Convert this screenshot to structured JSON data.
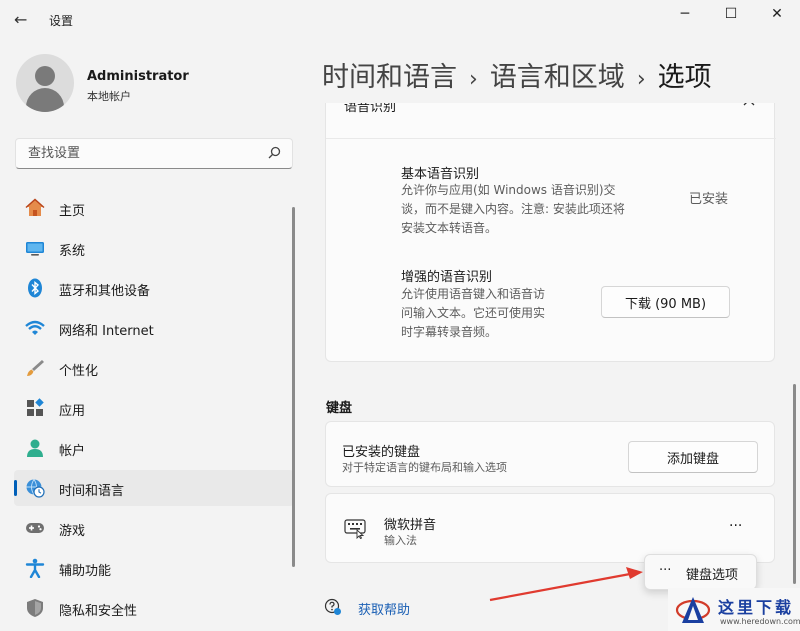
{
  "window": {
    "title": "设置",
    "back_label": "←",
    "minimize": "─",
    "maximize": "☐",
    "close": "✕"
  },
  "user": {
    "name": "Administrator",
    "account_type": "本地帐户"
  },
  "search": {
    "placeholder": "查找设置"
  },
  "nav": [
    {
      "label": "主页",
      "icon": "home-icon"
    },
    {
      "label": "系统",
      "icon": "system-icon"
    },
    {
      "label": "蓝牙和其他设备",
      "icon": "bluetooth-icon"
    },
    {
      "label": "网络和 Internet",
      "icon": "wifi-icon"
    },
    {
      "label": "个性化",
      "icon": "brush-icon"
    },
    {
      "label": "应用",
      "icon": "apps-icon"
    },
    {
      "label": "帐户",
      "icon": "account-icon"
    },
    {
      "label": "时间和语言",
      "icon": "globe-clock-icon",
      "selected": true
    },
    {
      "label": "游戏",
      "icon": "gamepad-icon"
    },
    {
      "label": "辅助功能",
      "icon": "accessibility-icon"
    },
    {
      "label": "隐私和安全性",
      "icon": "shield-icon"
    }
  ],
  "breadcrumb": {
    "level1": "时间和语言",
    "level2": "语言和区域",
    "current": "选项",
    "separator": "›"
  },
  "speech": {
    "partial_header": "语音识别",
    "basic": {
      "title": "基本语音识别",
      "desc1": "允许你与应用(如 Windows 语音识别)交",
      "desc2": "谈，而不是键入内容。注意: 安装此项还将",
      "desc3": "安装文本转语音。",
      "status": "已安装"
    },
    "enhanced": {
      "title": "增强的语音识别",
      "desc1": "允许使用语音键入和语音访",
      "desc2": "问输入文本。它还可使用实",
      "desc3": "时字幕转录音频。",
      "button": "下载 (90 MB)"
    }
  },
  "keyboard": {
    "section_title": "键盘",
    "installed": {
      "title": "已安装的键盘",
      "desc": "对于特定语言的键布局和输入选项",
      "button": "添加键盘"
    },
    "ime": {
      "name": "微软拼音",
      "type": "输入法",
      "more": "···"
    },
    "menu": {
      "dots": "···",
      "label": "键盘选项"
    }
  },
  "help": {
    "label": "获取帮助"
  },
  "watermark": {
    "text": "这里下载",
    "url": "www.heredown.com"
  },
  "colors": {
    "accent": "#005fb8",
    "arrow": "#e03a2f"
  }
}
